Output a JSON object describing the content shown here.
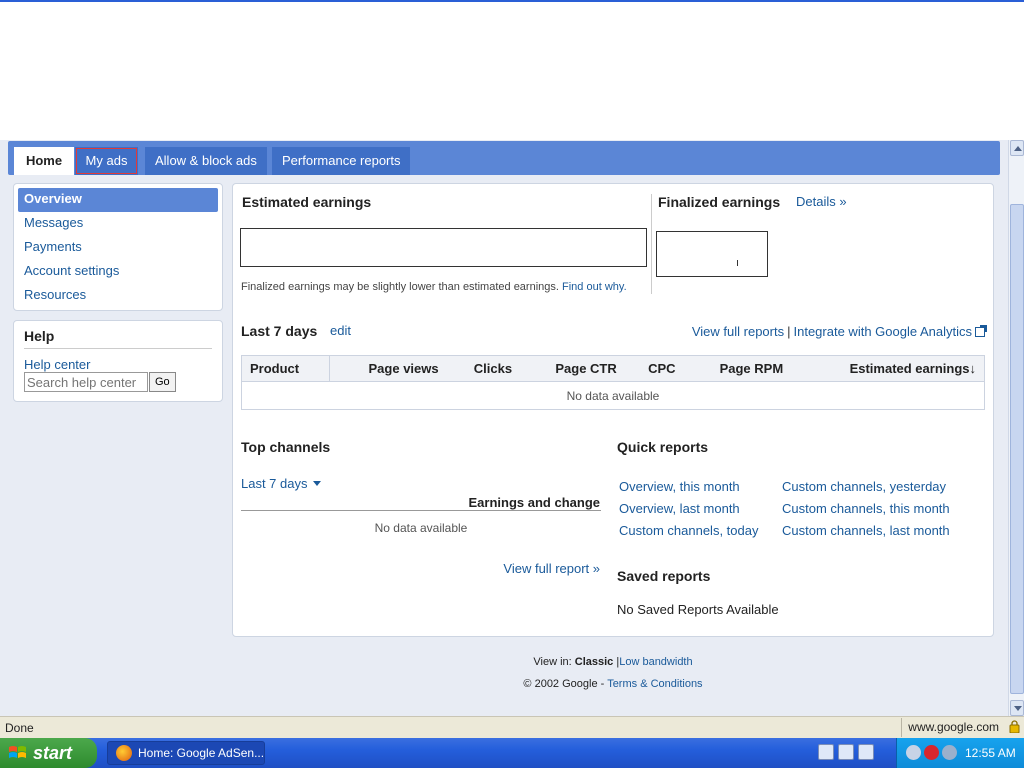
{
  "tabs": {
    "home": "Home",
    "my_ads": "My ads",
    "allow_block": "Allow & block ads",
    "performance": "Performance reports"
  },
  "leftnav": {
    "overview": "Overview",
    "messages": "Messages",
    "payments": "Payments",
    "account_settings": "Account settings",
    "resources": "Resources"
  },
  "help": {
    "title": "Help",
    "help_center": "Help center",
    "search_placeholder": "Search help center",
    "go": "Go"
  },
  "estimated": {
    "title": "Estimated earnings",
    "note": "Finalized earnings may be slightly lower than estimated earnings.",
    "note_link": "Find out why."
  },
  "finalized": {
    "title": "Finalized earnings",
    "details": "Details »"
  },
  "last7": {
    "title": "Last 7 days",
    "edit": "edit",
    "view_full": "View full reports",
    "separator": "|",
    "integrate": "Integrate with Google Analytics"
  },
  "table": {
    "columns": [
      "Product",
      "Page views",
      "Clicks",
      "Page CTR",
      "CPC",
      "Page RPM",
      "Estimated earnings"
    ],
    "sort_arrow": "↓",
    "empty": "No data available"
  },
  "top_channels": {
    "title": "Top channels",
    "range": "Last 7 days",
    "column": "Earnings and change",
    "empty": "No data available",
    "view_full": "View full report »"
  },
  "quick_reports": {
    "title": "Quick reports",
    "left": [
      "Overview, this month",
      "Overview, last month",
      "Custom channels, today"
    ],
    "right": [
      "Custom channels, yesterday",
      "Custom channels, this month",
      "Custom channels, last month"
    ]
  },
  "saved_reports": {
    "title": "Saved reports",
    "empty": "No Saved Reports Available"
  },
  "footer": {
    "view_in": "View in:",
    "classic": "Classic",
    "sep": "|",
    "low_bandwidth": "Low bandwidth",
    "copyright": "© 2002 Google",
    "dash": "-",
    "terms": "Terms & Conditions"
  },
  "statusbar": {
    "status": "Done",
    "url": "www.google.com"
  },
  "taskbar": {
    "start": "start",
    "window": "Home: Google AdSen...",
    "clock": "12:55 AM"
  },
  "colors": {
    "tab_bar": "#5b86d6",
    "link": "#1a5a9a",
    "page_bg": "#e8ecf4"
  }
}
